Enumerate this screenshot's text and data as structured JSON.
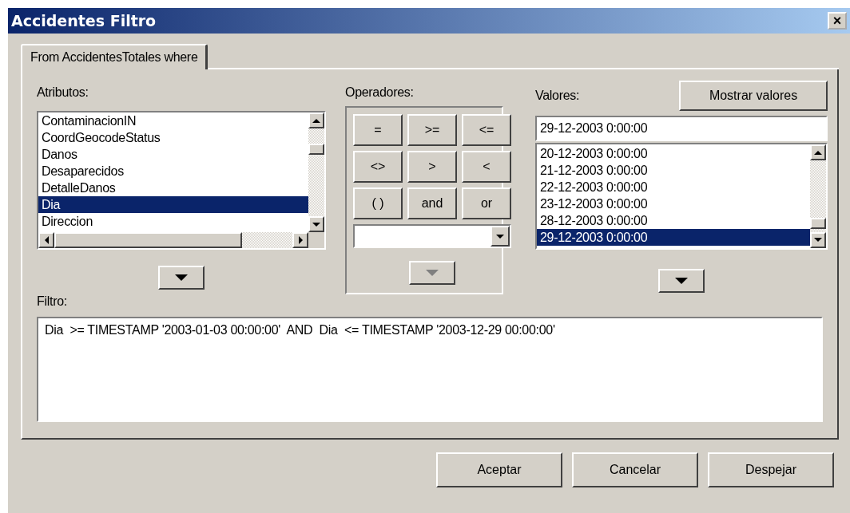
{
  "window": {
    "title": "Accidentes Filtro",
    "close": "×"
  },
  "tabs": [
    {
      "label": "From AccidentesTotales where",
      "selected": true
    }
  ],
  "attributes": {
    "label": "Atributos:",
    "items": [
      {
        "label": "ContaminacionIN",
        "selected": false
      },
      {
        "label": "CoordGeocodeStatus",
        "selected": false
      },
      {
        "label": "Danos",
        "selected": false
      },
      {
        "label": "Desaparecidos",
        "selected": false
      },
      {
        "label": "DetalleDanos",
        "selected": false
      },
      {
        "label": "Dia",
        "selected": true
      },
      {
        "label": "Direccion",
        "selected": false
      }
    ]
  },
  "operators": {
    "label": "Operadores:",
    "buttons": [
      "=",
      ">=",
      "<=",
      "<>",
      ">",
      "<",
      "( )",
      "and",
      "or"
    ],
    "insert_disabled": true
  },
  "values": {
    "label": "Valores:",
    "show_button": "Mostrar valores",
    "value": "29-12-2003 0:00:00",
    "items": [
      {
        "label": "20-12-2003 0:00:00",
        "selected": false
      },
      {
        "label": "21-12-2003 0:00:00",
        "selected": false
      },
      {
        "label": "22-12-2003 0:00:00",
        "selected": false
      },
      {
        "label": "23-12-2003 0:00:00",
        "selected": false
      },
      {
        "label": "28-12-2003 0:00:00",
        "selected": false
      },
      {
        "label": "29-12-2003 0:00:00",
        "selected": true
      }
    ]
  },
  "filter": {
    "label": "Filtro:",
    "value": "Dia  >= TIMESTAMP '2003-01-03 00:00:00'  AND  Dia  <= TIMESTAMP '2003-12-29 00:00:00'"
  },
  "buttons": [
    "Aceptar",
    "Cancelar",
    "Despejar"
  ]
}
